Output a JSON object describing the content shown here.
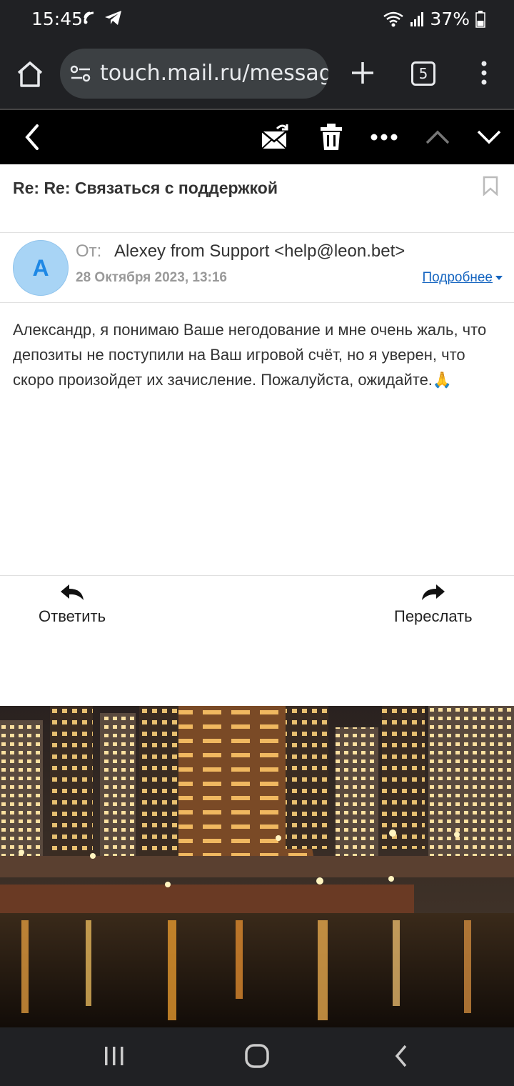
{
  "status_bar": {
    "time": "15:45",
    "battery": "37%",
    "icons": [
      "signal-booster-icon",
      "telegram-icon",
      "wifi-icon",
      "cell-signal-icon",
      "battery-icon"
    ]
  },
  "browser": {
    "url": "touch.mail.ru/message",
    "tab_count": "5"
  },
  "mail": {
    "subject": "Re: Re: Связаться с поддержкой",
    "from_label": "От:",
    "from": "Alexey from Support <help@leon.bet>",
    "avatar_letter": "A",
    "date": "28 Октября 2023, 13:16",
    "details_link": "Подробнее",
    "body": "Александр, я понимаю Ваше негодование и мне очень жаль, что депозиты не поступили на Ваш игровой счёт, но я уверен, что скоро произойдет их зачисление. Пожалуйста, ожидайте.",
    "body_emoji": "🙏"
  },
  "actions": {
    "reply": "Ответить",
    "forward": "Переслать"
  },
  "colors": {
    "browser_bg": "#202124",
    "toolbar_bg": "#000000",
    "avatar_bg": "#a8d4f5",
    "avatar_fg": "#1e88e5",
    "link": "#1565c0"
  }
}
